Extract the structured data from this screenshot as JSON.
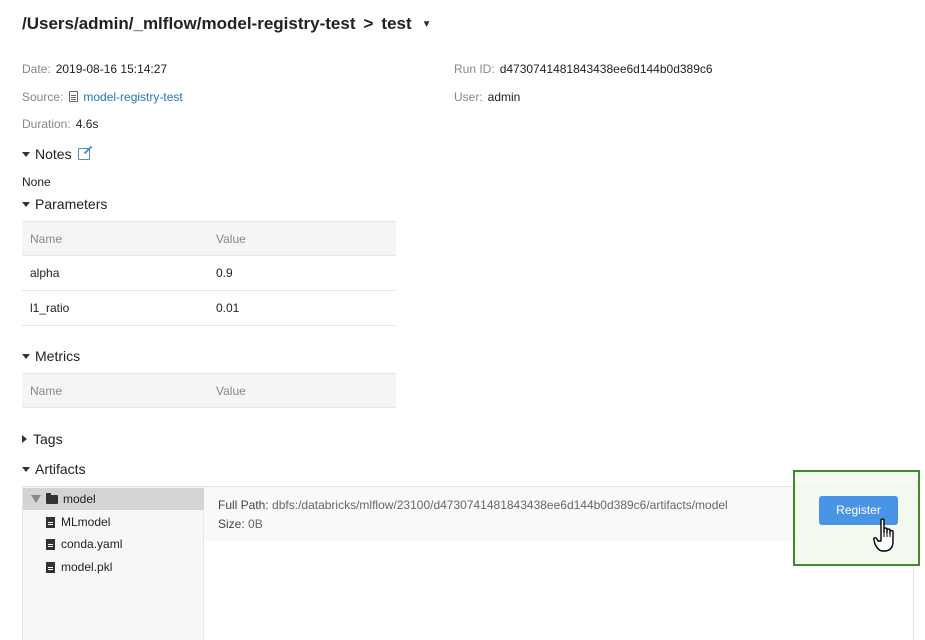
{
  "breadcrumb": {
    "path": "/Users/admin/_mlflow/model-registry-test",
    "separator": ">",
    "run_name": "test"
  },
  "meta": {
    "date_label": "Date:",
    "date_value": "2019-08-16 15:14:27",
    "source_label": "Source:",
    "source_value": "model-registry-test",
    "duration_label": "Duration:",
    "duration_value": "4.6s",
    "run_id_label": "Run ID:",
    "run_id_value": "d4730741481843438ee6d144b0d389c6",
    "user_label": "User:",
    "user_value": "admin"
  },
  "notes": {
    "label": "Notes",
    "value": "None"
  },
  "parameters": {
    "label": "Parameters",
    "columns": [
      "Name",
      "Value"
    ],
    "rows": [
      [
        "alpha",
        "0.9"
      ],
      [
        "l1_ratio",
        "0.01"
      ]
    ]
  },
  "metrics": {
    "label": "Metrics",
    "columns": [
      "Name",
      "Value"
    ]
  },
  "tags": {
    "label": "Tags"
  },
  "artifacts": {
    "label": "Artifacts",
    "tree": [
      {
        "name": "model",
        "type": "folder",
        "expanded": true,
        "selected": true
      },
      {
        "name": "MLmodel",
        "type": "file"
      },
      {
        "name": "conda.yaml",
        "type": "file"
      },
      {
        "name": "model.pkl",
        "type": "file"
      }
    ],
    "full_path_label": "Full Path:",
    "full_path_value": "dbfs:/databricks/mlflow/23100/d4730741481843438ee6d144b0d389c6/artifacts/model",
    "size_label": "Size:",
    "size_value": "0B",
    "register_label": "Register"
  },
  "colors": {
    "link": "#2373c7",
    "button": "#4a94e8",
    "highlight_border": "#3f8a2c"
  }
}
